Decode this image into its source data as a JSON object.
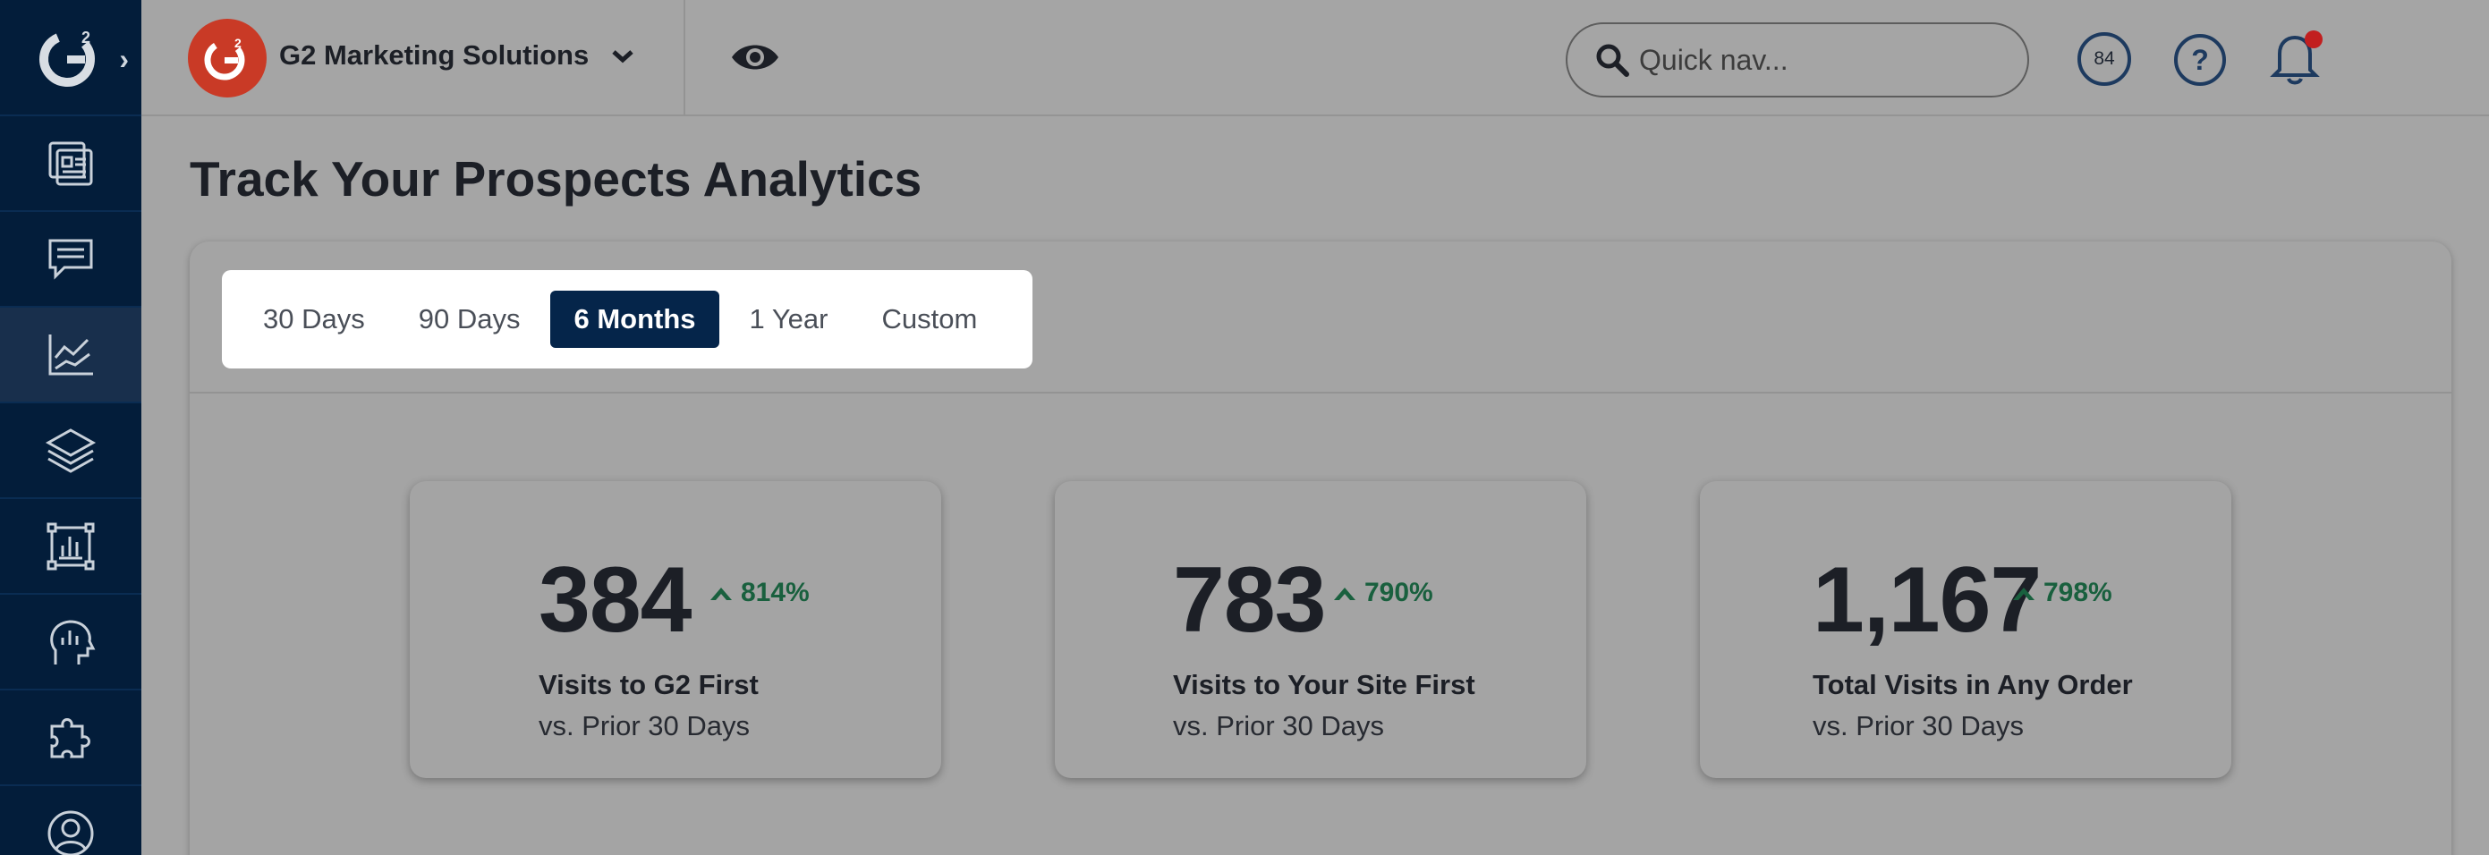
{
  "sidebar": {
    "items": [
      {
        "icon": "dashboard-icon"
      },
      {
        "icon": "chat-icon"
      },
      {
        "icon": "line-chart-icon",
        "active": true
      },
      {
        "icon": "layers-icon"
      },
      {
        "icon": "report-icon"
      },
      {
        "icon": "head-analytics-icon"
      },
      {
        "icon": "puzzle-icon"
      },
      {
        "icon": "user-circle-icon"
      }
    ]
  },
  "header": {
    "org_name": "G2 Marketing Solutions",
    "search_placeholder": "Quick nav...",
    "score": "84"
  },
  "page": {
    "title": "Track Your Prospects Analytics"
  },
  "ranges": [
    "30 Days",
    "90 Days",
    "6 Months",
    "1 Year",
    "Custom"
  ],
  "active_range": "6 Months",
  "cards": [
    {
      "value": "384",
      "delta": "814%",
      "label": "Visits to G2 First",
      "sub": "vs. Prior 30 Days"
    },
    {
      "value": "783",
      "delta": "790%",
      "label": "Visits to Your Site First",
      "sub": "vs. Prior 30 Days"
    },
    {
      "value": "1,167",
      "delta": "798%",
      "label": "Total Visits in Any Order",
      "sub": "vs. Prior 30 Days"
    }
  ],
  "colors": {
    "sidebar": "#031d3a",
    "accent_active": "#05254a",
    "brand_red": "#c93a26",
    "delta_green": "#19603e"
  }
}
